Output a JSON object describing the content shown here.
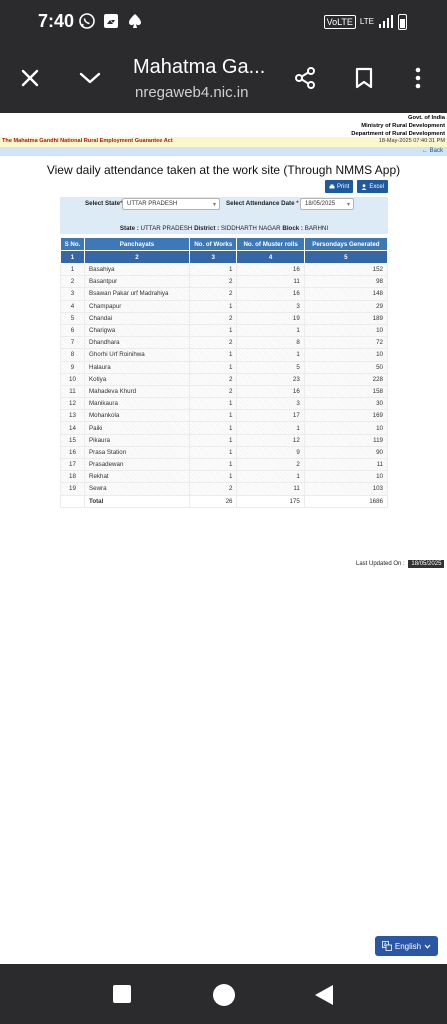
{
  "status_bar": {
    "time": "7:40",
    "volte": "VoLTE",
    "lte": "LTE"
  },
  "browser": {
    "title": "Mahatma Ga...",
    "url": "nregaweb4.nic.in"
  },
  "gov_header": {
    "lines": [
      "Govt. of India",
      "Ministry of Rural Development",
      "Department of Rural Development"
    ],
    "act": "The Mahatma Gandhi National Rural Employment Guarantee Act",
    "datetime": "18-May-2025 07:40:31 PM"
  },
  "back_label": "← Back",
  "page_title": "View daily attendance taken at the work site (Through NMMS App)",
  "buttons": {
    "print": "Print",
    "excel": "Excel"
  },
  "filters": {
    "state_label": "Select State",
    "state_value": "UTTAR PRADESH",
    "date_label": "Select Attendance Date",
    "date_value": "18/05/2025"
  },
  "summary": {
    "state_label": "State :",
    "state": "UTTAR PRADESH",
    "district_label": "District :",
    "district": "SIDDHARTH NAGAR",
    "block_label": "Block :",
    "block": "BARHNI"
  },
  "table": {
    "headers": [
      "S No.",
      "Panchayats",
      "No. of Works",
      "No. of Muster rolls",
      "Persondays Generated"
    ],
    "col_numbers": [
      "1",
      "2",
      "3",
      "4",
      "5"
    ],
    "rows": [
      [
        "1",
        "Basahiya",
        "1",
        "16",
        "152"
      ],
      [
        "2",
        "Basantpur",
        "2",
        "11",
        "98"
      ],
      [
        "3",
        "Bsawan Pakar urf Madrahiya",
        "2",
        "16",
        "148"
      ],
      [
        "4",
        "Champapur",
        "1",
        "3",
        "29"
      ],
      [
        "5",
        "Chandai",
        "2",
        "19",
        "189"
      ],
      [
        "6",
        "Charigwa",
        "1",
        "1",
        "10"
      ],
      [
        "7",
        "Dhandhara",
        "2",
        "8",
        "72"
      ],
      [
        "8",
        "Ghorhi Urf Roinihwa",
        "1",
        "1",
        "10"
      ],
      [
        "9",
        "Halaura",
        "1",
        "5",
        "50"
      ],
      [
        "10",
        "Kotiya",
        "2",
        "23",
        "228"
      ],
      [
        "11",
        "Mahadeva Khurd",
        "2",
        "16",
        "158"
      ],
      [
        "12",
        "Manikaura",
        "1",
        "3",
        "30"
      ],
      [
        "13",
        "Mohankola",
        "1",
        "17",
        "169"
      ],
      [
        "14",
        "Paiki",
        "1",
        "1",
        "10"
      ],
      [
        "15",
        "Pikaura",
        "1",
        "12",
        "119"
      ],
      [
        "16",
        "Prasa Station",
        "1",
        "9",
        "90"
      ],
      [
        "17",
        "Prasadewan",
        "1",
        "2",
        "11"
      ],
      [
        "18",
        "Rekhat",
        "1",
        "1",
        "10"
      ],
      [
        "19",
        "Sewra",
        "2",
        "11",
        "103"
      ]
    ],
    "total": {
      "label": "Total",
      "works": "26",
      "musters": "175",
      "persondays": "1686"
    }
  },
  "last_updated": {
    "label": "Last Updated On :",
    "date": "18/05/2025"
  },
  "language_button": "English"
}
